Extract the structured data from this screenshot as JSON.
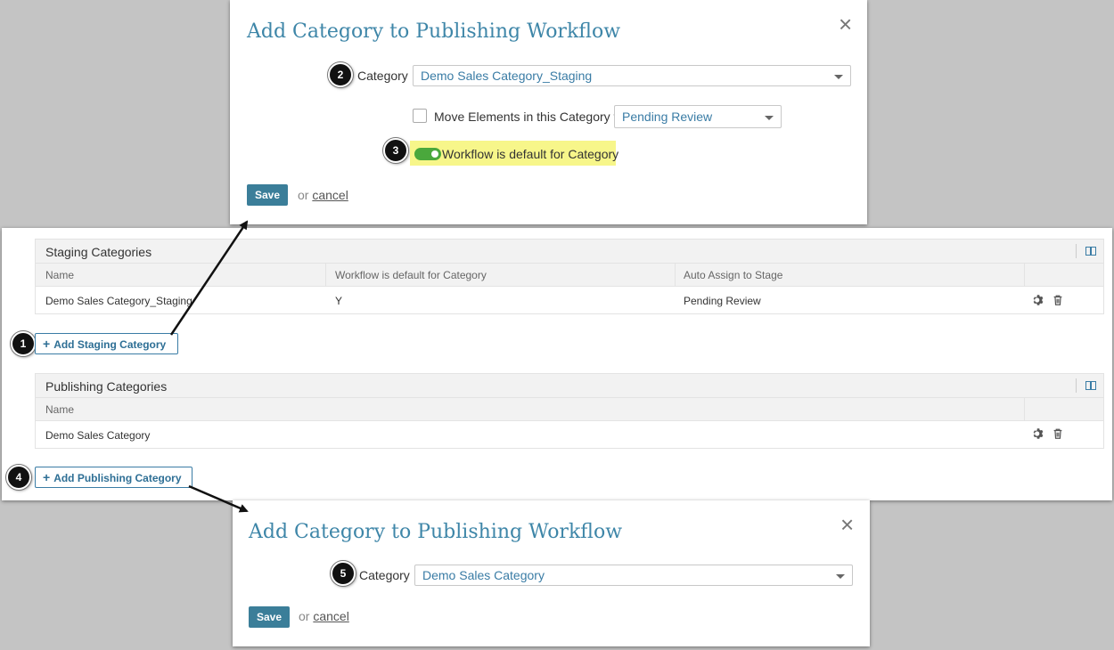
{
  "dialog_top": {
    "title": "Add Category to Publishing Workflow",
    "close_glyph": "×",
    "badge_category": "2",
    "category_label": "Category",
    "category_value": "Demo Sales Category_Staging",
    "move_label": "Move Elements in this Category to",
    "move_value": "Pending Review",
    "badge_toggle": "3",
    "toggle_label": "Workflow is default for Category",
    "save_label": "Save",
    "or_text": "or",
    "cancel_label": "cancel"
  },
  "staging": {
    "header": "Staging Categories",
    "columns": [
      "Name",
      "Workflow is default for Category",
      "Auto Assign to Stage"
    ],
    "rows": [
      {
        "name": "Demo Sales Category_Staging",
        "default": "Y",
        "stage": "Pending Review"
      }
    ],
    "badge": "1",
    "add_label": "Add Staging Category"
  },
  "publishing": {
    "header": "Publishing Categories",
    "columns": [
      "Name"
    ],
    "rows": [
      {
        "name": "Demo Sales Category"
      }
    ],
    "badge": "4",
    "add_label": "Add Publishing Category"
  },
  "dialog_bottom": {
    "title": "Add Category to Publishing Workflow",
    "close_glyph": "×",
    "badge_category": "5",
    "category_label": "Category",
    "category_value": "Demo Sales Category",
    "save_label": "Save",
    "or_text": "or",
    "cancel_label": "cancel"
  },
  "icons": {
    "plus": "+",
    "gear": "gear-icon",
    "trash": "trash-icon",
    "columns": "columns-icon"
  },
  "colors": {
    "accent": "#3a7ca5",
    "save_button": "#3b7e99",
    "toggle_on": "#4aa83c",
    "highlight": "#f7f68a"
  }
}
